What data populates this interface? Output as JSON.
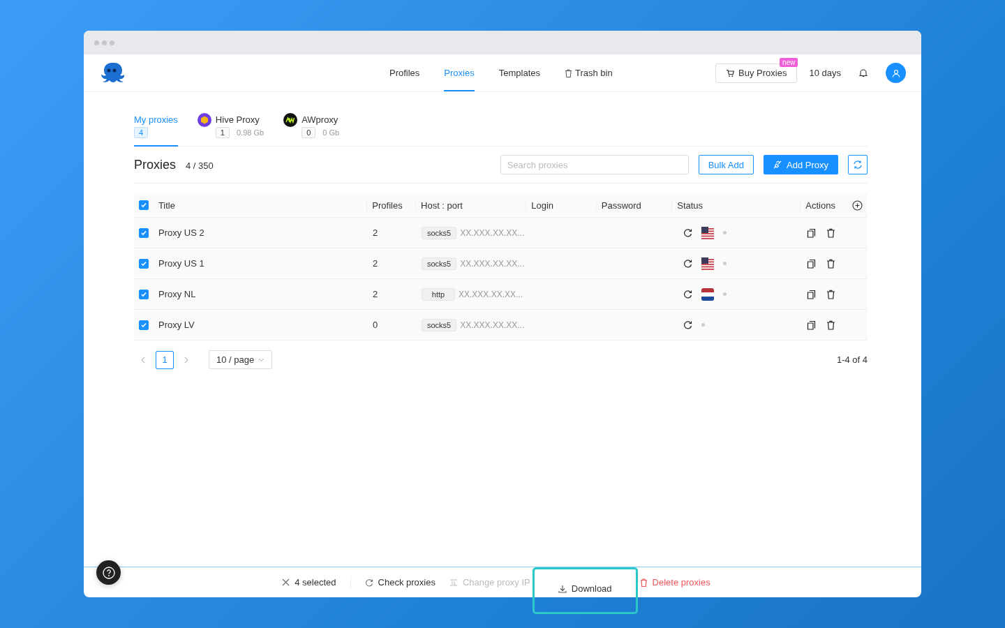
{
  "nav": [
    {
      "label": "Profiles",
      "selected": false,
      "icon": false
    },
    {
      "label": "Proxies",
      "selected": true,
      "icon": false
    },
    {
      "label": "Templates",
      "selected": false,
      "icon": false
    },
    {
      "label": "Trash bin",
      "selected": false,
      "icon": true
    }
  ],
  "header": {
    "buy_button": "Buy Proxies",
    "buy_badge": "new",
    "days": "10 days"
  },
  "provider_tabs": [
    {
      "kind": "mine",
      "label": "My proxies",
      "count": "4",
      "selected": true
    },
    {
      "kind": "hive",
      "label": "Hive Proxy",
      "count": "1",
      "traffic": "0.98 Gb",
      "selected": false
    },
    {
      "kind": "aw",
      "label": "AWproxy",
      "count": "0",
      "traffic": "0 Gb",
      "selected": false
    }
  ],
  "toolbar": {
    "title": "Proxies",
    "count": "4 / 350",
    "search_placeholder": "Search proxies",
    "bulk_add": "Bulk Add",
    "add_proxy": "Add Proxy"
  },
  "table": {
    "all_checked": true,
    "columns": [
      "Title",
      "Profiles",
      "Host : port",
      "Login",
      "Password",
      "Status",
      "Actions"
    ],
    "rows": [
      {
        "checked": true,
        "title": "Proxy US 2",
        "profiles": "2",
        "protocol": "socks5",
        "host": "XX.XXX.XX.XX...",
        "kind": "us"
      },
      {
        "checked": true,
        "title": "Proxy US 1",
        "profiles": "2",
        "protocol": "socks5",
        "host": "XX.XXX.XX.XX...",
        "kind": "us"
      },
      {
        "checked": true,
        "title": "Proxy NL",
        "profiles": "2",
        "protocol": "http",
        "host": "XX.XXX.XX.XX...",
        "kind": "nl"
      },
      {
        "checked": true,
        "title": "Proxy LV",
        "profiles": "0",
        "protocol": "socks5",
        "host": "XX.XXX.XX.XX...",
        "kind": "none"
      }
    ]
  },
  "pagination": {
    "page": "1",
    "page_size": "10 / page",
    "range": "1-4 of 4"
  },
  "action_bar": [
    {
      "kind": "close",
      "label": "4 selected",
      "disabled": false
    },
    {
      "kind": "check",
      "label": "Check proxies",
      "disabled": false
    },
    {
      "kind": "change",
      "label": "Change proxy IP",
      "disabled": true
    },
    {
      "kind": "download",
      "label": "Download",
      "disabled": false,
      "highlighted": true
    },
    {
      "kind": "delete",
      "label": "Delete proxies",
      "disabled": false
    }
  ]
}
